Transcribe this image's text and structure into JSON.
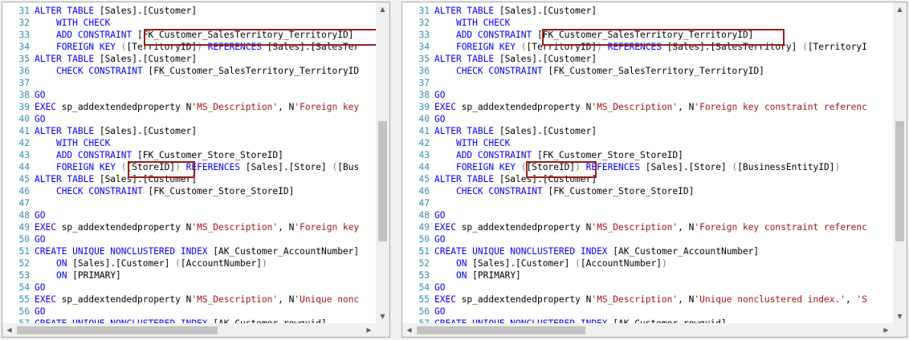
{
  "colors": {
    "keyword": "#0000ff",
    "string": "#a31515",
    "gray": "#808080",
    "plain": "#000000",
    "line_number": "#2b91af",
    "highlight": "#9b1c1c"
  },
  "icons": {
    "up": "arrow-up-icon",
    "down": "arrow-down-icon",
    "left": "arrow-left-icon",
    "right": "arrow-right-icon"
  },
  "left_pane": {
    "lines": [
      {
        "n": "31",
        "t": [
          [
            "k",
            "ALTER TABLE "
          ],
          [
            "p",
            "[Sales].[Customer]"
          ]
        ]
      },
      {
        "n": "32",
        "t": [
          [
            "p",
            "    "
          ],
          [
            "k",
            "WITH CHECK"
          ]
        ]
      },
      {
        "n": "33",
        "t": [
          [
            "p",
            "    "
          ],
          [
            "k",
            "ADD CONSTRAINT "
          ],
          [
            "p",
            "[FK_Customer_SalesTerritory_TerritoryID]"
          ]
        ]
      },
      {
        "n": "34",
        "t": [
          [
            "p",
            "    "
          ],
          [
            "k",
            "FOREIGN KEY "
          ],
          [
            "g",
            "("
          ],
          [
            "p",
            "[TerritoryID]"
          ],
          [
            "g",
            ")"
          ],
          [
            "k",
            " REFERENCES "
          ],
          [
            "p",
            "[Sales].[SalesTer"
          ]
        ]
      },
      {
        "n": "35",
        "t": [
          [
            "k",
            "ALTER TABLE "
          ],
          [
            "p",
            "[Sales].[Customer]"
          ]
        ]
      },
      {
        "n": "36",
        "t": [
          [
            "p",
            "    "
          ],
          [
            "k",
            "CHECK CONSTRAINT "
          ],
          [
            "p",
            "[FK_Customer_SalesTerritory_TerritoryID"
          ]
        ]
      },
      {
        "n": "37",
        "t": []
      },
      {
        "n": "38",
        "t": [
          [
            "k",
            "GO"
          ]
        ]
      },
      {
        "n": "39",
        "t": [
          [
            "k",
            "EXEC "
          ],
          [
            "p",
            "sp_addextendedproperty N"
          ],
          [
            "s",
            "'MS_Description'"
          ],
          [
            "p",
            ", N"
          ],
          [
            "s",
            "'Foreign key"
          ]
        ]
      },
      {
        "n": "40",
        "t": [
          [
            "k",
            "GO"
          ]
        ]
      },
      {
        "n": "41",
        "t": [
          [
            "k",
            "ALTER TABLE "
          ],
          [
            "p",
            "[Sales].[Customer]"
          ]
        ]
      },
      {
        "n": "42",
        "t": [
          [
            "p",
            "    "
          ],
          [
            "k",
            "WITH CHECK"
          ]
        ]
      },
      {
        "n": "43",
        "t": [
          [
            "p",
            "    "
          ],
          [
            "k",
            "ADD CONSTRAINT "
          ],
          [
            "p",
            "[FK_Customer_Store_StoreID]"
          ]
        ]
      },
      {
        "n": "44",
        "t": [
          [
            "p",
            "    "
          ],
          [
            "k",
            "FOREIGN KEY "
          ],
          [
            "g",
            "("
          ],
          [
            "p",
            "[StoreID]"
          ],
          [
            "g",
            ")"
          ],
          [
            "k",
            " REFERENCES "
          ],
          [
            "p",
            "[Sales].[Store] "
          ],
          [
            "g",
            "("
          ],
          [
            "p",
            "[Bus"
          ]
        ]
      },
      {
        "n": "45",
        "t": [
          [
            "k",
            "ALTER TABLE "
          ],
          [
            "p",
            "[Sales].[Customer]"
          ]
        ]
      },
      {
        "n": "46",
        "t": [
          [
            "p",
            "    "
          ],
          [
            "k",
            "CHECK CONSTRAINT "
          ],
          [
            "p",
            "[FK_Customer_Store_StoreID]"
          ]
        ]
      },
      {
        "n": "47",
        "t": []
      },
      {
        "n": "48",
        "t": [
          [
            "k",
            "GO"
          ]
        ]
      },
      {
        "n": "49",
        "t": [
          [
            "k",
            "EXEC "
          ],
          [
            "p",
            "sp_addextendedproperty N"
          ],
          [
            "s",
            "'MS_Description'"
          ],
          [
            "p",
            ", N"
          ],
          [
            "s",
            "'Foreign key"
          ]
        ]
      },
      {
        "n": "50",
        "t": [
          [
            "k",
            "GO"
          ]
        ]
      },
      {
        "n": "51",
        "t": [
          [
            "k",
            "CREATE UNIQUE NONCLUSTERED INDEX "
          ],
          [
            "p",
            "[AK_Customer_AccountNumber]"
          ]
        ]
      },
      {
        "n": "52",
        "t": [
          [
            "p",
            "    "
          ],
          [
            "k",
            "ON "
          ],
          [
            "p",
            "[Sales].[Customer] "
          ],
          [
            "g",
            "("
          ],
          [
            "p",
            "[AccountNumber]"
          ],
          [
            "g",
            ")"
          ]
        ]
      },
      {
        "n": "53",
        "t": [
          [
            "p",
            "    "
          ],
          [
            "k",
            "ON "
          ],
          [
            "p",
            "[PRIMARY]"
          ]
        ]
      },
      {
        "n": "54",
        "t": [
          [
            "k",
            "GO"
          ]
        ]
      },
      {
        "n": "55",
        "t": [
          [
            "k",
            "EXEC "
          ],
          [
            "p",
            "sp_addextendedproperty N"
          ],
          [
            "s",
            "'MS_Description'"
          ],
          [
            "p",
            ", N"
          ],
          [
            "s",
            "'Unique nonc"
          ]
        ]
      },
      {
        "n": "56",
        "t": [
          [
            "k",
            "GO"
          ]
        ]
      },
      {
        "n": "57",
        "t": [
          [
            "k",
            "CREATE UNIQUE NONCLUSTERED INDEX "
          ],
          [
            "p",
            "[AK_Customer_rowguid]"
          ]
        ]
      }
    ]
  },
  "right_pane": {
    "lines": [
      {
        "n": "31",
        "t": [
          [
            "k",
            "ALTER TABLE "
          ],
          [
            "p",
            "[Sales].[Customer]"
          ]
        ]
      },
      {
        "n": "32",
        "t": [
          [
            "p",
            "    "
          ],
          [
            "k",
            "WITH CHECK"
          ]
        ]
      },
      {
        "n": "33",
        "t": [
          [
            "p",
            "    "
          ],
          [
            "k",
            "ADD CONSTRAINT "
          ],
          [
            "p",
            "[FK_Customer_SalesTerritory_TerritoryID]"
          ]
        ]
      },
      {
        "n": "34",
        "t": [
          [
            "p",
            "    "
          ],
          [
            "k",
            "FOREIGN KEY "
          ],
          [
            "g",
            "("
          ],
          [
            "p",
            "[TerritoryID]"
          ],
          [
            "g",
            ")"
          ],
          [
            "k",
            " REFERENCES "
          ],
          [
            "p",
            "[Sales].[SalesTerritory] "
          ],
          [
            "g",
            "("
          ],
          [
            "p",
            "[TerritoryI"
          ]
        ]
      },
      {
        "n": "35",
        "t": [
          [
            "k",
            "ALTER TABLE "
          ],
          [
            "p",
            "[Sales].[Customer]"
          ]
        ]
      },
      {
        "n": "36",
        "t": [
          [
            "p",
            "    "
          ],
          [
            "k",
            "CHECK CONSTRAINT "
          ],
          [
            "p",
            "[FK_Customer_SalesTerritory_TerritoryID]"
          ]
        ]
      },
      {
        "n": "37",
        "t": []
      },
      {
        "n": "38",
        "t": [
          [
            "k",
            "GO"
          ]
        ]
      },
      {
        "n": "39",
        "t": [
          [
            "k",
            "EXEC "
          ],
          [
            "p",
            "sp_addextendedproperty N"
          ],
          [
            "s",
            "'MS_Description'"
          ],
          [
            "p",
            ", N"
          ],
          [
            "s",
            "'Foreign key constraint referenc"
          ]
        ]
      },
      {
        "n": "40",
        "t": [
          [
            "k",
            "GO"
          ]
        ]
      },
      {
        "n": "41",
        "t": [
          [
            "k",
            "ALTER TABLE "
          ],
          [
            "p",
            "[Sales].[Customer]"
          ]
        ]
      },
      {
        "n": "42",
        "t": [
          [
            "p",
            "    "
          ],
          [
            "k",
            "WITH CHECK"
          ]
        ]
      },
      {
        "n": "43",
        "t": [
          [
            "p",
            "    "
          ],
          [
            "k",
            "ADD CONSTRAINT "
          ],
          [
            "p",
            "[FK_Customer_Store_StoreID]"
          ]
        ]
      },
      {
        "n": "44",
        "t": [
          [
            "p",
            "    "
          ],
          [
            "k",
            "FOREIGN KEY "
          ],
          [
            "g",
            "("
          ],
          [
            "p",
            "[StoreID]"
          ],
          [
            "g",
            ")"
          ],
          [
            "k",
            " REFERENCES "
          ],
          [
            "p",
            "[Sales].[Store] "
          ],
          [
            "g",
            "("
          ],
          [
            "p",
            "[BusinessEntityID]"
          ],
          [
            "g",
            ")"
          ]
        ]
      },
      {
        "n": "45",
        "t": [
          [
            "k",
            "ALTER TABLE "
          ],
          [
            "p",
            "[Sales].[Customer]"
          ]
        ]
      },
      {
        "n": "46",
        "t": [
          [
            "p",
            "    "
          ],
          [
            "k",
            "CHECK CONSTRAINT "
          ],
          [
            "p",
            "[FK_Customer_Store_StoreID]"
          ]
        ]
      },
      {
        "n": "47",
        "t": []
      },
      {
        "n": "48",
        "t": [
          [
            "k",
            "GO"
          ]
        ]
      },
      {
        "n": "49",
        "t": [
          [
            "k",
            "EXEC "
          ],
          [
            "p",
            "sp_addextendedproperty N"
          ],
          [
            "s",
            "'MS_Description'"
          ],
          [
            "p",
            ", N"
          ],
          [
            "s",
            "'Foreign key constraint referenc"
          ]
        ]
      },
      {
        "n": "50",
        "t": [
          [
            "k",
            "GO"
          ]
        ]
      },
      {
        "n": "51",
        "t": [
          [
            "k",
            "CREATE UNIQUE NONCLUSTERED INDEX "
          ],
          [
            "p",
            "[AK_Customer_AccountNumber]"
          ]
        ]
      },
      {
        "n": "52",
        "t": [
          [
            "p",
            "    "
          ],
          [
            "k",
            "ON "
          ],
          [
            "p",
            "[Sales].[Customer] "
          ],
          [
            "g",
            "("
          ],
          [
            "p",
            "[AccountNumber]"
          ],
          [
            "g",
            ")"
          ]
        ]
      },
      {
        "n": "53",
        "t": [
          [
            "p",
            "    "
          ],
          [
            "k",
            "ON "
          ],
          [
            "p",
            "[PRIMARY]"
          ]
        ]
      },
      {
        "n": "54",
        "t": [
          [
            "k",
            "GO"
          ]
        ]
      },
      {
        "n": "55",
        "t": [
          [
            "k",
            "EXEC "
          ],
          [
            "p",
            "sp_addextendedproperty N"
          ],
          [
            "s",
            "'MS_Description'"
          ],
          [
            "p",
            ", N"
          ],
          [
            "s",
            "'Unique nonclustered index.'"
          ],
          [
            "p",
            ", "
          ],
          [
            "s",
            "'S"
          ]
        ]
      },
      {
        "n": "56",
        "t": [
          [
            "k",
            "GO"
          ]
        ]
      },
      {
        "n": "57",
        "t": [
          [
            "k",
            "CREATE UNIQUE NONCLUSTERED INDEX "
          ],
          [
            "p",
            "[AK_Customer_rowguid]"
          ]
        ]
      }
    ]
  }
}
